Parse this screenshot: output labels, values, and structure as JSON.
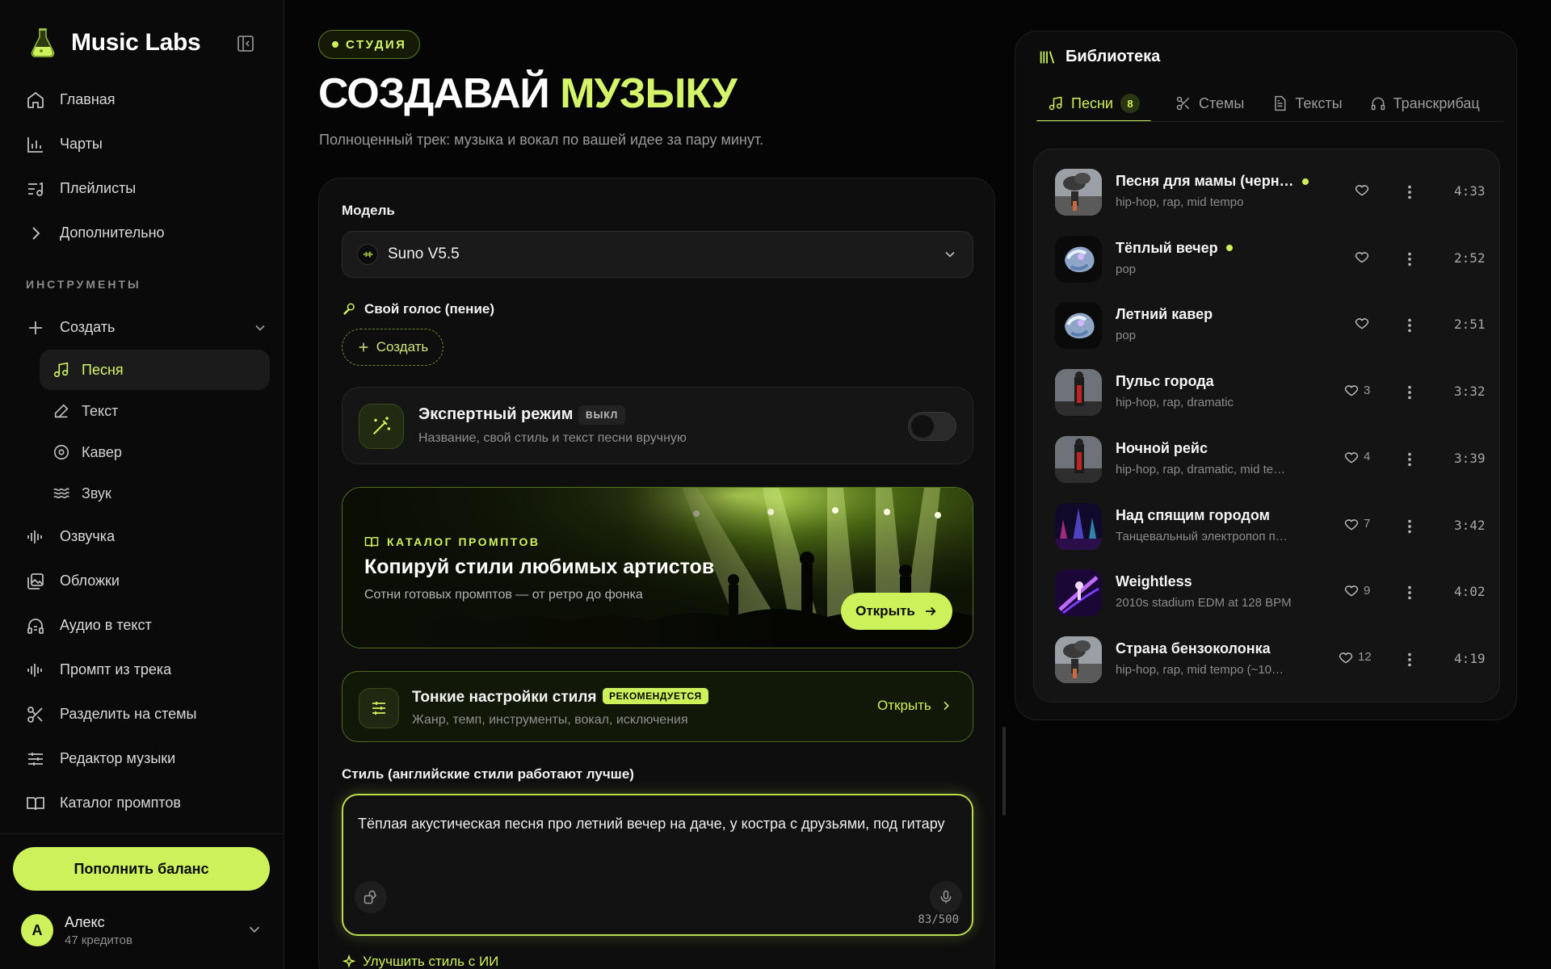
{
  "app": {
    "name": "Music Labs"
  },
  "colors": {
    "accent": "#cdf15a",
    "bg": "#050505",
    "panel": "#0e0e0e"
  },
  "nav": {
    "items": [
      {
        "label": "Главная",
        "icon": "home-icon"
      },
      {
        "label": "Чарты",
        "icon": "chart-icon"
      },
      {
        "label": "Плейлисты",
        "icon": "playlist-icon"
      },
      {
        "label": "Дополнительно",
        "icon": "chevron-right-icon"
      }
    ]
  },
  "tools": {
    "section_label": "ИНСТРУМЕНТЫ",
    "create_label": "Создать",
    "create_sub": [
      {
        "label": "Песня",
        "icon": "music-note-icon",
        "active": true
      },
      {
        "label": "Текст",
        "icon": "pen-icon"
      },
      {
        "label": "Кавер",
        "icon": "disc-icon"
      },
      {
        "label": "Звук",
        "icon": "wave-icon"
      }
    ],
    "items": [
      {
        "label": "Озвучка",
        "icon": "waveform-icon"
      },
      {
        "label": "Обложки",
        "icon": "image-stack-icon"
      },
      {
        "label": "Аудио в текст",
        "icon": "headphones-text-icon"
      },
      {
        "label": "Промпт из трека",
        "icon": "waveform-icon"
      },
      {
        "label": "Разделить на стемы",
        "icon": "scissors-icon"
      },
      {
        "label": "Редактор музыки",
        "icon": "sliders-icon"
      },
      {
        "label": "Каталог промптов",
        "icon": "book-icon"
      }
    ]
  },
  "topup_label": "Пополнить баланс",
  "user": {
    "initial": "А",
    "name": "Алекс",
    "credits": "47 кредитов"
  },
  "main": {
    "badge": "СТУДИЯ",
    "title_main": "СОЗДАВАЙ ",
    "title_accent": "МУЗЫКУ",
    "subtitle": "Полноценный трек: музыка и вокал по вашей идее за пару минут.",
    "model_label": "Модель",
    "model_value": "Suno V5.5",
    "voice_label": "Свой голос (пение)",
    "voice_create": "Создать",
    "expert": {
      "title": "Экспертный режим",
      "state": "ВЫКЛ",
      "desc": "Название, свой стиль и текст песни вручную",
      "enabled": false
    },
    "promo": {
      "kicker": "КАТАЛОГ ПРОМПТОВ",
      "title": "Копируй стили любимых артистов",
      "subtitle": "Сотни готовых промптов — от ретро до фонка",
      "button": "Открыть"
    },
    "fine": {
      "title": "Тонкие настройки стиля",
      "badge": "РЕКОМЕНДУЕТСЯ",
      "desc": "Жанр, темп, инструменты, вокал, исключения",
      "open": "Открыть"
    },
    "style_label": "Стиль (английские стили работают лучше)",
    "style_value": "Тёплая акустическая песня про летний вечер на даче, у костра с друзьями, под гитару",
    "style_count": "83/500",
    "improve": "Улучшить стиль с ИИ"
  },
  "library": {
    "title": "Библиотека",
    "tabs": [
      {
        "label": "Песни",
        "count": "8",
        "active": true
      },
      {
        "label": "Стемы"
      },
      {
        "label": "Тексты"
      },
      {
        "label": "Транскрибац"
      }
    ],
    "songs": [
      {
        "title": "Песня для мамы (черн…",
        "tags": "hip-hop, rap, mid tempo",
        "new": true,
        "likes": "",
        "duration": "4:33",
        "cover": "smoke"
      },
      {
        "title": "Тёплый вечер",
        "tags": "pop",
        "new": true,
        "likes": "",
        "duration": "2:52",
        "cover": "chrome"
      },
      {
        "title": "Летний кавер",
        "tags": "pop",
        "new": false,
        "likes": "",
        "duration": "2:51",
        "cover": "chrome"
      },
      {
        "title": "Пульс города",
        "tags": "hip-hop, rap, dramatic",
        "new": false,
        "likes": "3",
        "duration": "3:32",
        "cover": "red"
      },
      {
        "title": "Ночной рейс",
        "tags": "hip-hop, rap, dramatic, mid te…",
        "new": false,
        "likes": "4",
        "duration": "3:39",
        "cover": "red"
      },
      {
        "title": "Над спящим городом",
        "tags": "Танцевальный электропоп п…",
        "new": false,
        "likes": "7",
        "duration": "3:42",
        "cover": "neon"
      },
      {
        "title": "Weightless",
        "tags": "2010s stadium EDM at 128 BPM",
        "new": false,
        "likes": "9",
        "duration": "4:02",
        "cover": "purple"
      },
      {
        "title": "Страна бензоколонка",
        "tags": "hip-hop, rap, mid tempo (~10…",
        "new": false,
        "likes": "12",
        "duration": "4:19",
        "cover": "smoke"
      }
    ]
  }
}
